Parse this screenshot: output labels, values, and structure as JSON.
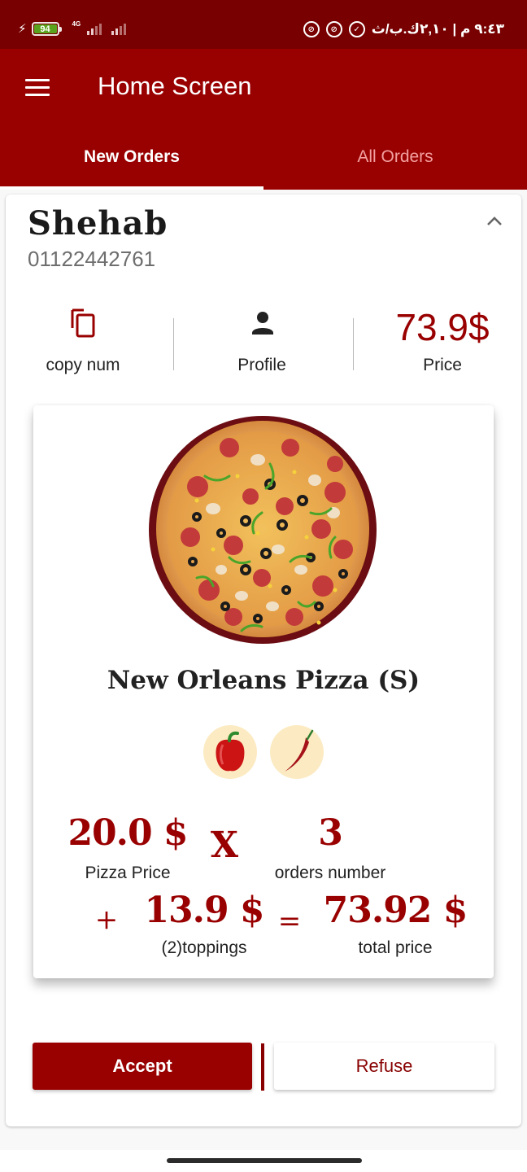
{
  "status_bar": {
    "battery_level": "94",
    "battery_fraction": 0.94,
    "network_type": "4G",
    "time_text": "٩:٤٣ م | ٢,١٠ك.ب/ث",
    "icons": [
      "charging-bolt-icon",
      "battery-icon",
      "signal-4g-icon",
      "signal-icon",
      "alarm-icon",
      "do-not-disturb-icon",
      "do-not-disturb-icon"
    ]
  },
  "app_bar": {
    "title": "Home Screen",
    "menu_icon": "menu-icon"
  },
  "tabs": [
    {
      "label": "New Orders",
      "active": true
    },
    {
      "label": "All Orders",
      "active": false
    }
  ],
  "order": {
    "customer_name": "Shehab",
    "phone": "01122442761",
    "collapse_icon": "chevron-up-icon",
    "actions": [
      {
        "label": "copy num",
        "icon": "copy-icon"
      },
      {
        "label": "Profile",
        "icon": "person-icon"
      },
      {
        "label": "Price",
        "value": "73.9$"
      }
    ],
    "item": {
      "name": "New Orleans Pizza (S)",
      "image": "pizza-image",
      "toppings": [
        {
          "name": "bell-pepper",
          "icon": "bell-pepper-icon"
        },
        {
          "name": "chili-pepper",
          "icon": "chili-pepper-icon"
        }
      ],
      "pizza_price": "20.0 $",
      "pizza_price_label": "Pizza Price",
      "multiply_sign": "X",
      "orders_number": "3",
      "orders_number_label": "orders number",
      "plus_sign": "+",
      "toppings_price": "13.9 $",
      "toppings_label": "(2)toppings",
      "equals_sign": "=",
      "total_price": "73.92 $",
      "total_price_label": "total price"
    },
    "buttons": {
      "accept": "Accept",
      "refuse": "Refuse"
    }
  },
  "colors": {
    "primary": "#990000",
    "status_bar": "#780000",
    "topping_bg": "#fcebc2"
  }
}
